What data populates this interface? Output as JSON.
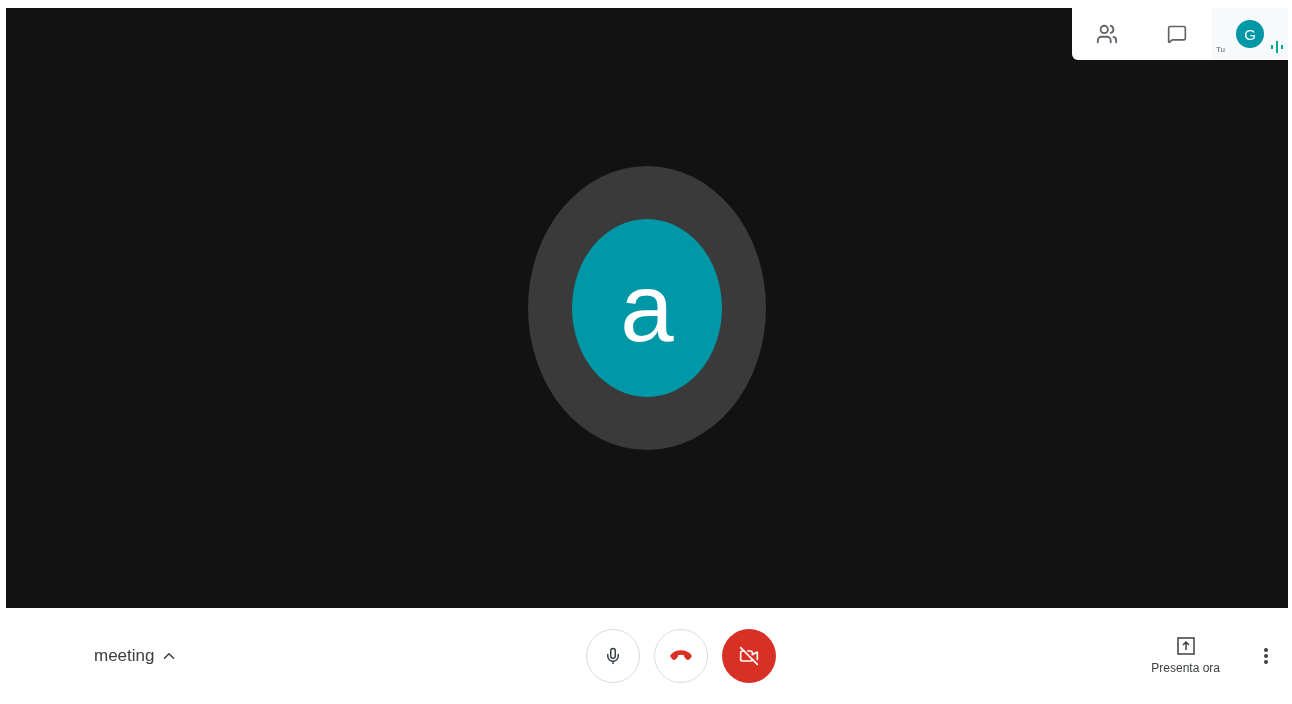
{
  "top_panel": {
    "self_label": "Tu",
    "self_avatar": "G",
    "speaking": true
  },
  "stage": {
    "participant_avatar": "a"
  },
  "bottom_bar": {
    "meeting_name": "meeting",
    "mic_on": true,
    "camera_on": false,
    "present_label": "Presenta ora"
  }
}
